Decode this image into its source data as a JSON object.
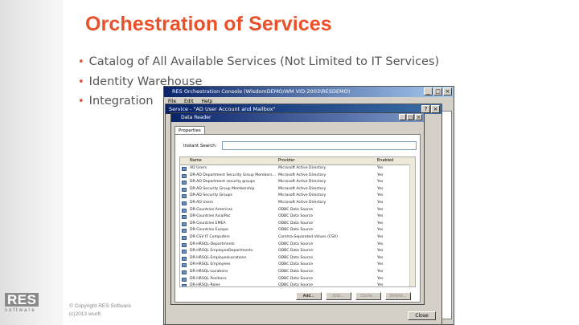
{
  "slide": {
    "title": "Orchestration of Services",
    "bullets": [
      "Catalog of All Available Services (Not Limited to IT Services)",
      "Identity Warehouse",
      "Integration"
    ],
    "logo_text": "RES",
    "logo_sub": "software",
    "copyright_line1": "© Copyright RES Software",
    "copyright_line2": "(c)2013 wsoft"
  },
  "back_window": {
    "title": "RES Orchestration Console (WisdomDEMO/WM VID-2003\\RESDEMO)",
    "menu": [
      "File",
      "Edit",
      "Help"
    ]
  },
  "mid_window": {
    "title": "Service - \"AD User Account and Mailbox\"",
    "close_label": "Close"
  },
  "data_reader": {
    "title": "Data Reader",
    "tab_label": "Properties",
    "search_label": "Instant Search:",
    "search_value": "",
    "columns": [
      "Name",
      "Provider",
      "Enabled"
    ],
    "rows": [
      {
        "name": "AD Users",
        "provider": "Microsoft Active Directory",
        "enabled": "Yes"
      },
      {
        "name": "DR-AD Department Security Group Members...",
        "provider": "Microsoft Active Directory",
        "enabled": "Yes"
      },
      {
        "name": "DR-AD Department security groups",
        "provider": "Microsoft Active Directory",
        "enabled": "Yes"
      },
      {
        "name": "DR-AD Security Group Membership",
        "provider": "Microsoft Active Directory",
        "enabled": "Yes"
      },
      {
        "name": "DR-AD Security Groups",
        "provider": "Microsoft Active Directory",
        "enabled": "Yes"
      },
      {
        "name": "DR-AD Users",
        "provider": "Microsoft Active Directory",
        "enabled": "Yes"
      },
      {
        "name": "DR-Countries Americas",
        "provider": "ODBC Data Source",
        "enabled": "Yes"
      },
      {
        "name": "DR-Countries Asia/Pac",
        "provider": "ODBC Data Source",
        "enabled": "Yes"
      },
      {
        "name": "DR-Countries EMEA",
        "provider": "ODBC Data Source",
        "enabled": "Yes"
      },
      {
        "name": "DR-Countries Europe",
        "provider": "ODBC Data Source",
        "enabled": "Yes"
      },
      {
        "name": "DR-CSV IT Computers",
        "provider": "Comma-Separated Values (CSV)",
        "enabled": "Yes"
      },
      {
        "name": "DR-HRSQL-Departments",
        "provider": "ODBC Data Source",
        "enabled": "Yes"
      },
      {
        "name": "DR-HRSQL EmployeeDepartments",
        "provider": "ODBC Data Source",
        "enabled": "Yes"
      },
      {
        "name": "DR-HRSQL-EmployeeLocations",
        "provider": "ODBC Data Source",
        "enabled": "Yes"
      },
      {
        "name": "DR-HRSQL Employees",
        "provider": "ODBC Data Source",
        "enabled": "Yes"
      },
      {
        "name": "DR-HRSQL-Locations",
        "provider": "ODBC Data Source",
        "enabled": "Yes"
      },
      {
        "name": "DR-HRSQL Positions",
        "provider": "ODBC Data Source",
        "enabled": "Yes"
      },
      {
        "name": "DR-HRSQL-Roles",
        "provider": "ODBC Data Source",
        "enabled": "Yes"
      }
    ],
    "buttons": [
      "Add...",
      "Edit...",
      "Clone...",
      "Delete..."
    ]
  }
}
